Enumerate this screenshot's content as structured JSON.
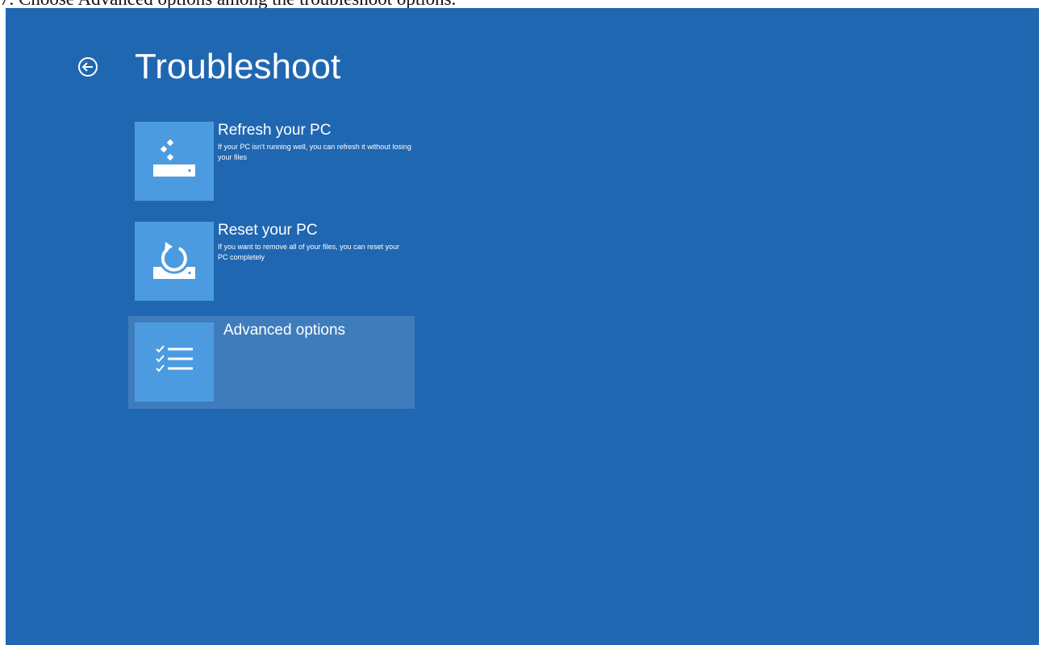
{
  "caption": "7. Choose Advanced options among the troubleshoot options.",
  "header": {
    "back_icon": "back-arrow-icon",
    "title": "Troubleshoot"
  },
  "options": [
    {
      "title": "Refresh your PC",
      "description": "If your PC isn't running well, you can refresh it without losing your files",
      "icon": "refresh-pc-icon",
      "selected": false
    },
    {
      "title": "Reset your PC",
      "description": "If you want to remove all of your files, you can reset your PC completely",
      "icon": "reset-pc-icon",
      "selected": false
    },
    {
      "title": "Advanced options",
      "description": "",
      "icon": "checklist-icon",
      "selected": true
    }
  ],
  "colors": {
    "background": "#2067b2",
    "tile": "#4c9be0",
    "text": "#ffffff"
  }
}
